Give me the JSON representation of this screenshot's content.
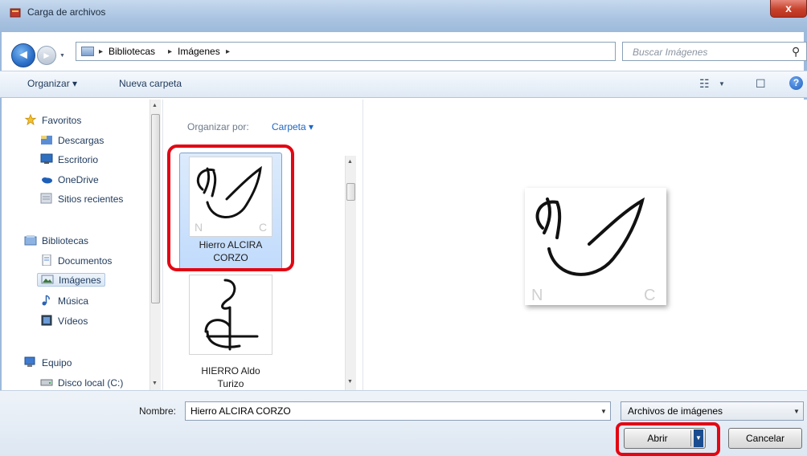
{
  "window": {
    "title": "Carga de archivos",
    "close_glyph": "x"
  },
  "address": {
    "crumbs": [
      "Bibliotecas",
      "Imágenes"
    ],
    "separator": "▸"
  },
  "search": {
    "placeholder": "Buscar Imágenes"
  },
  "toolbar": {
    "organize_label": "Organizar ▾",
    "new_folder_label": "Nueva carpeta",
    "help_glyph": "?"
  },
  "nav": {
    "favorites": {
      "label": "Favoritos",
      "items": [
        "Descargas",
        "Escritorio",
        "OneDrive",
        "Sitios recientes"
      ]
    },
    "libraries": {
      "label": "Bibliotecas",
      "items": [
        "Documentos",
        "Imágenes",
        "Música",
        "Vídeos"
      ],
      "selected": "Imágenes"
    },
    "computer": {
      "label": "Equipo",
      "items": [
        "Disco local (C:)"
      ]
    }
  },
  "list": {
    "arrange_label": "Organizar por:",
    "arrange_value": "Carpeta ▾",
    "files": [
      {
        "name_line1": "Hierro ALCIRA",
        "name_line2": "CORZO",
        "selected": true
      },
      {
        "name_line1": "HIERRO Aldo",
        "name_line2": "Turizo",
        "selected": false
      }
    ]
  },
  "footer": {
    "filename_label": "Nombre:",
    "filename_value": "Hierro ALCIRA CORZO",
    "filetype_value": "Archivos de imágenes",
    "open_label": "Abrir",
    "cancel_label": "Cancelar"
  },
  "colors": {
    "highlight": "#e30613",
    "selection": "#c1dbfc",
    "link": "#1d66c5"
  },
  "icons": [
    "window-app-icon",
    "back-arrow-icon",
    "forward-arrow-icon",
    "folder-icon",
    "refresh-icon",
    "search-icon",
    "view-options-icon",
    "preview-pane-icon",
    "help-icon",
    "star-icon",
    "downloads-icon",
    "desktop-icon",
    "onedrive-icon",
    "recent-places-icon",
    "library-icon",
    "documents-icon",
    "pictures-icon",
    "music-icon",
    "videos-icon",
    "computer-icon",
    "disk-icon"
  ]
}
